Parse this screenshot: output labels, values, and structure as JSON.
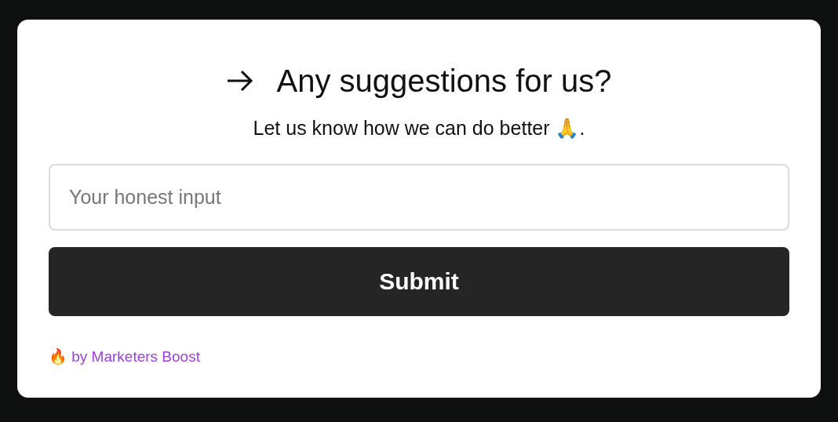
{
  "title": "Any suggestions for us?",
  "subtitle": "Let us know how we can do better 🙏.",
  "input": {
    "placeholder": "Your honest input"
  },
  "submit_button": "Submit",
  "footer_link": "🔥 by Marketers Boost"
}
